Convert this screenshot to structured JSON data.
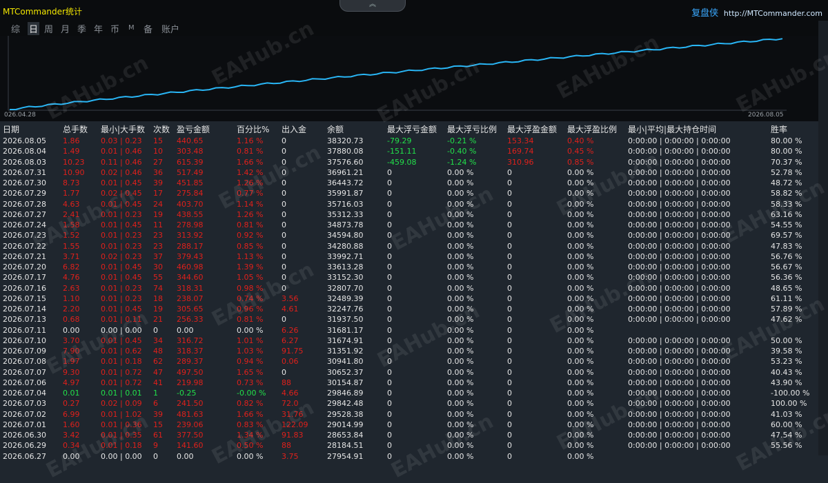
{
  "app": {
    "title": "MTCommander统计",
    "brand_name": "复盘侠",
    "brand_url": "http://MTCommander.com",
    "handle_icon": "chevron-up-icon"
  },
  "periods": [
    {
      "label": "综",
      "active": false
    },
    {
      "label": "日",
      "active": true
    },
    {
      "label": "周",
      "active": false
    },
    {
      "label": "月",
      "active": false
    },
    {
      "label": "季",
      "active": false
    },
    {
      "label": "年",
      "active": false
    },
    {
      "label": "币",
      "active": false
    },
    {
      "label": "M",
      "active": false
    },
    {
      "label": "备",
      "active": false
    },
    {
      "label": "账户",
      "active": false
    }
  ],
  "chart_data": {
    "type": "line",
    "x_start": "026.04.28",
    "x_end": "2026.08.05",
    "line_color": "#29b6f6",
    "trend": "steady upward equity curve"
  },
  "watermark": "EAHub.cn",
  "headers": [
    "日期",
    "总手数",
    "最小|大手数",
    "次数",
    "盈亏金额",
    "百分比%",
    "出入金",
    "余额",
    "最大浮亏金额",
    "最大浮亏比例",
    "最大浮盈金额",
    "最大浮盈比例",
    "最小|平均|最大持仓时间",
    "胜率"
  ],
  "colors": {
    "red": "#e0201b",
    "green": "#22e04a",
    "white": "#e6e6e6"
  },
  "rows": [
    {
      "date": "2026.08.05",
      "lots": "1.86",
      "minmax": "0.03 | 0.23",
      "count": "15",
      "pnl": "440.65",
      "pct": "1.16 %",
      "io": "0",
      "bal": "38320.73",
      "fl": "-79.29",
      "flp": "-0.21 %",
      "fp": "153.34",
      "fpp": "0.40 %",
      "hold": "0:00:00 | 0:00:00 | 0:00:00",
      "win": "80.00 %",
      "c": "r",
      "fc": "g"
    },
    {
      "date": "2026.08.04",
      "lots": "1.49",
      "minmax": "0.01 | 0.46",
      "count": "10",
      "pnl": "303.48",
      "pct": "0.81 %",
      "io": "0",
      "bal": "37880.08",
      "fl": "-151.11",
      "flp": "-0.40 %",
      "fp": "169.74",
      "fpp": "0.45 %",
      "hold": "0:00:00 | 0:00:00 | 0:00:00",
      "win": "80.00 %",
      "c": "r",
      "fc": "g"
    },
    {
      "date": "2026.08.03",
      "lots": "10.23",
      "minmax": "0.11 | 0.46",
      "count": "27",
      "pnl": "615.39",
      "pct": "1.66 %",
      "io": "0",
      "bal": "37576.60",
      "fl": "-459.08",
      "flp": "-1.24 %",
      "fp": "310.96",
      "fpp": "0.85 %",
      "hold": "0:00:00 | 0:00:00 | 0:00:00",
      "win": "70.37 %",
      "c": "r",
      "fc": "g"
    },
    {
      "date": "2026.07.31",
      "lots": "10.90",
      "minmax": "0.02 | 0.46",
      "count": "36",
      "pnl": "517.49",
      "pct": "1.42 %",
      "io": "0",
      "bal": "36961.21",
      "fl": "0",
      "flp": "0.00 %",
      "fp": "0",
      "fpp": "0.00 %",
      "hold": "0:00:00 | 0:00:00 | 0:00:00",
      "win": "52.78 %",
      "c": "r",
      "fc": "w"
    },
    {
      "date": "2026.07.30",
      "lots": "8.73",
      "minmax": "0.01 | 0.45",
      "count": "39",
      "pnl": "451.85",
      "pct": "1.26 %",
      "io": "0",
      "bal": "36443.72",
      "fl": "0",
      "flp": "0.00 %",
      "fp": "0",
      "fpp": "0.00 %",
      "hold": "0:00:00 | 0:00:00 | 0:00:00",
      "win": "48.72 %",
      "c": "r",
      "fc": "w"
    },
    {
      "date": "2026.07.29",
      "lots": "1.77",
      "minmax": "0.02 | 0.45",
      "count": "17",
      "pnl": "275.84",
      "pct": "0.77 %",
      "io": "0",
      "bal": "35991.87",
      "fl": "0",
      "flp": "0.00 %",
      "fp": "0",
      "fpp": "0.00 %",
      "hold": "0:00:00 | 0:00:00 | 0:00:00",
      "win": "58.82 %",
      "c": "r",
      "fc": "w"
    },
    {
      "date": "2026.07.28",
      "lots": "4.63",
      "minmax": "0.01 | 0.45",
      "count": "24",
      "pnl": "403.70",
      "pct": "1.14 %",
      "io": "0",
      "bal": "35716.03",
      "fl": "0",
      "flp": "0.00 %",
      "fp": "0",
      "fpp": "0.00 %",
      "hold": "0:00:00 | 0:00:00 | 0:00:00",
      "win": "58.33 %",
      "c": "r",
      "fc": "w"
    },
    {
      "date": "2026.07.27",
      "lots": "2.41",
      "minmax": "0.01 | 0.23",
      "count": "19",
      "pnl": "438.55",
      "pct": "1.26 %",
      "io": "0",
      "bal": "35312.33",
      "fl": "0",
      "flp": "0.00 %",
      "fp": "0",
      "fpp": "0.00 %",
      "hold": "0:00:00 | 0:00:00 | 0:00:00",
      "win": "63.16 %",
      "c": "r",
      "fc": "w"
    },
    {
      "date": "2026.07.24",
      "lots": "1.58",
      "minmax": "0.01 | 0.45",
      "count": "11",
      "pnl": "278.98",
      "pct": "0.81 %",
      "io": "0",
      "bal": "34873.78",
      "fl": "0",
      "flp": "0.00 %",
      "fp": "0",
      "fpp": "0.00 %",
      "hold": "0:00:00 | 0:00:00 | 0:00:00",
      "win": "54.55 %",
      "c": "r",
      "fc": "w"
    },
    {
      "date": "2026.07.23",
      "lots": "1.52",
      "minmax": "0.01 | 0.23",
      "count": "23",
      "pnl": "313.92",
      "pct": "0.92 %",
      "io": "0",
      "bal": "34594.80",
      "fl": "0",
      "flp": "0.00 %",
      "fp": "0",
      "fpp": "0.00 %",
      "hold": "0:00:00 | 0:00:00 | 0:00:00",
      "win": "69.57 %",
      "c": "r",
      "fc": "w"
    },
    {
      "date": "2026.07.22",
      "lots": "1.55",
      "minmax": "0.01 | 0.23",
      "count": "23",
      "pnl": "288.17",
      "pct": "0.85 %",
      "io": "0",
      "bal": "34280.88",
      "fl": "0",
      "flp": "0.00 %",
      "fp": "0",
      "fpp": "0.00 %",
      "hold": "0:00:00 | 0:00:00 | 0:00:00",
      "win": "47.83 %",
      "c": "r",
      "fc": "w"
    },
    {
      "date": "2026.07.21",
      "lots": "3.71",
      "minmax": "0.02 | 0.23",
      "count": "37",
      "pnl": "379.43",
      "pct": "1.13 %",
      "io": "0",
      "bal": "33992.71",
      "fl": "0",
      "flp": "0.00 %",
      "fp": "0",
      "fpp": "0.00 %",
      "hold": "0:00:00 | 0:00:00 | 0:00:00",
      "win": "56.76 %",
      "c": "r",
      "fc": "w"
    },
    {
      "date": "2026.07.20",
      "lots": "6.82",
      "minmax": "0.01 | 0.45",
      "count": "30",
      "pnl": "460.98",
      "pct": "1.39 %",
      "io": "0",
      "bal": "33613.28",
      "fl": "0",
      "flp": "0.00 %",
      "fp": "0",
      "fpp": "0.00 %",
      "hold": "0:00:00 | 0:00:00 | 0:00:00",
      "win": "56.67 %",
      "c": "r",
      "fc": "w"
    },
    {
      "date": "2026.07.17",
      "lots": "4.76",
      "minmax": "0.01 | 0.45",
      "count": "55",
      "pnl": "344.60",
      "pct": "1.05 %",
      "io": "0",
      "bal": "33152.30",
      "fl": "0",
      "flp": "0.00 %",
      "fp": "0",
      "fpp": "0.00 %",
      "hold": "0:00:00 | 0:00:00 | 0:00:00",
      "win": "56.36 %",
      "c": "r",
      "fc": "w"
    },
    {
      "date": "2026.07.16",
      "lots": "2.63",
      "minmax": "0.01 | 0.23",
      "count": "74",
      "pnl": "318.31",
      "pct": "0.98 %",
      "io": "0",
      "bal": "32807.70",
      "fl": "0",
      "flp": "0.00 %",
      "fp": "0",
      "fpp": "0.00 %",
      "hold": "0:00:00 | 0:00:00 | 0:00:00",
      "win": "48.65 %",
      "c": "r",
      "fc": "w"
    },
    {
      "date": "2026.07.15",
      "lots": "1.10",
      "minmax": "0.01 | 0.23",
      "count": "18",
      "pnl": "238.07",
      "pct": "0.74 %",
      "io": "3.56",
      "bal": "32489.39",
      "fl": "0",
      "flp": "0.00 %",
      "fp": "0",
      "fpp": "0.00 %",
      "hold": "0:00:00 | 0:00:00 | 0:00:00",
      "win": "61.11 %",
      "c": "r",
      "fc": "w"
    },
    {
      "date": "2026.07.14",
      "lots": "2.20",
      "minmax": "0.01 | 0.45",
      "count": "19",
      "pnl": "305.65",
      "pct": "0.96 %",
      "io": "4.61",
      "bal": "32247.76",
      "fl": "0",
      "flp": "0.00 %",
      "fp": "0",
      "fpp": "0.00 %",
      "hold": "0:00:00 | 0:00:00 | 0:00:00",
      "win": "57.89 %",
      "c": "r",
      "fc": "w"
    },
    {
      "date": "2026.07.13",
      "lots": "0.68",
      "minmax": "0.01 | 0.11",
      "count": "21",
      "pnl": "256.33",
      "pct": "0.81 %",
      "io": "0",
      "bal": "31937.50",
      "fl": "0",
      "flp": "0.00 %",
      "fp": "0",
      "fpp": "0.00 %",
      "hold": "0:00:00 | 0:00:00 | 0:00:00",
      "win": "47.62 %",
      "c": "r",
      "fc": "w"
    },
    {
      "date": "2026.07.11",
      "lots": "0.00",
      "minmax": "0.00 | 0.00",
      "count": "0",
      "pnl": "0.00",
      "pct": "0.00 %",
      "io": "6.26",
      "bal": "31681.17",
      "fl": "0",
      "flp": "0.00 %",
      "fp": "0",
      "fpp": "0.00 %",
      "hold": "",
      "win": "",
      "c": "w",
      "fc": "w",
      "io_c": "r"
    },
    {
      "date": "2026.07.10",
      "lots": "3.70",
      "minmax": "0.01 | 0.45",
      "count": "34",
      "pnl": "316.72",
      "pct": "1.01 %",
      "io": "6.27",
      "bal": "31674.91",
      "fl": "0",
      "flp": "0.00 %",
      "fp": "0",
      "fpp": "0.00 %",
      "hold": "0:00:00 | 0:00:00 | 0:00:00",
      "win": "50.00 %",
      "c": "r",
      "fc": "w"
    },
    {
      "date": "2026.07.09",
      "lots": "7.90",
      "minmax": "0.01 | 0.62",
      "count": "48",
      "pnl": "318.37",
      "pct": "1.03 %",
      "io": "91.75",
      "bal": "31351.92",
      "fl": "0",
      "flp": "0.00 %",
      "fp": "0",
      "fpp": "0.00 %",
      "hold": "0:00:00 | 0:00:00 | 0:00:00",
      "win": "39.58 %",
      "c": "r",
      "fc": "w"
    },
    {
      "date": "2026.07.08",
      "lots": "1.97",
      "minmax": "0.01 | 0.18",
      "count": "62",
      "pnl": "289.37",
      "pct": "0.94 %",
      "io": "0.06",
      "bal": "30941.80",
      "fl": "0",
      "flp": "0.00 %",
      "fp": "0",
      "fpp": "0.00 %",
      "hold": "0:00:00 | 0:00:00 | 0:00:00",
      "win": "53.23 %",
      "c": "r",
      "fc": "w"
    },
    {
      "date": "2026.07.07",
      "lots": "9.30",
      "minmax": "0.01 | 0.72",
      "count": "47",
      "pnl": "497.50",
      "pct": "1.65 %",
      "io": "0",
      "bal": "30652.37",
      "fl": "0",
      "flp": "0.00 %",
      "fp": "0",
      "fpp": "0.00 %",
      "hold": "0:00:00 | 0:00:00 | 0:00:00",
      "win": "40.43 %",
      "c": "r",
      "fc": "w"
    },
    {
      "date": "2026.07.06",
      "lots": "4.97",
      "minmax": "0.01 | 0.72",
      "count": "41",
      "pnl": "219.98",
      "pct": "0.73 %",
      "io": "88",
      "bal": "30154.87",
      "fl": "0",
      "flp": "0.00 %",
      "fp": "0",
      "fpp": "0.00 %",
      "hold": "0:00:00 | 0:00:00 | 0:00:00",
      "win": "43.90 %",
      "c": "r",
      "fc": "w"
    },
    {
      "date": "2026.07.04",
      "lots": "0.01",
      "minmax": "0.01 | 0.01",
      "count": "1",
      "pnl": "-0.25",
      "pct": "-0.00 %",
      "io": "4.66",
      "bal": "29846.89",
      "fl": "0",
      "flp": "0.00 %",
      "fp": "0",
      "fpp": "0.00 %",
      "hold": "0:00:00 | 0:00:00 | 0:00:00",
      "win": "-100.00 %",
      "c": "g",
      "fc": "w",
      "io_c": "r"
    },
    {
      "date": "2026.07.03",
      "lots": "0.27",
      "minmax": "0.02 | 0.09",
      "count": "6",
      "pnl": "241.50",
      "pct": "0.82 %",
      "io": "72.0",
      "bal": "29842.48",
      "fl": "0",
      "flp": "0.00 %",
      "fp": "0",
      "fpp": "0.00 %",
      "hold": "0:00:00 | 0:00:00 | 0:00:00",
      "win": "100.00 %",
      "c": "r",
      "fc": "w"
    },
    {
      "date": "2026.07.02",
      "lots": "6.99",
      "minmax": "0.01 | 1.02",
      "count": "39",
      "pnl": "481.63",
      "pct": "1.66 %",
      "io": "31.76",
      "bal": "29528.38",
      "fl": "0",
      "flp": "0.00 %",
      "fp": "0",
      "fpp": "0.00 %",
      "hold": "0:00:00 | 0:00:00 | 0:00:00",
      "win": "41.03 %",
      "c": "r",
      "fc": "w"
    },
    {
      "date": "2026.07.01",
      "lots": "1.60",
      "minmax": "0.01 | 0.36",
      "count": "15",
      "pnl": "239.06",
      "pct": "0.83 %",
      "io": "122.09",
      "bal": "29014.99",
      "fl": "0",
      "flp": "0.00 %",
      "fp": "0",
      "fpp": "0.00 %",
      "hold": "0:00:00 | 0:00:00 | 0:00:00",
      "win": "60.00 %",
      "c": "r",
      "fc": "w"
    },
    {
      "date": "2026.06.30",
      "lots": "3.42",
      "minmax": "0.01 | 0.35",
      "count": "61",
      "pnl": "377.50",
      "pct": "1.34 %",
      "io": "91.83",
      "bal": "28653.84",
      "fl": "0",
      "flp": "0.00 %",
      "fp": "0",
      "fpp": "0.00 %",
      "hold": "0:00:00 | 0:00:00 | 0:00:00",
      "win": "47.54 %",
      "c": "r",
      "fc": "w"
    },
    {
      "date": "2026.06.29",
      "lots": "0.34",
      "minmax": "0.01 | 0.18",
      "count": "9",
      "pnl": "141.60",
      "pct": "0.50 %",
      "io": "88",
      "bal": "28184.51",
      "fl": "0",
      "flp": "0.00 %",
      "fp": "0",
      "fpp": "0.00 %",
      "hold": "0:00:00 | 0:00:00 | 0:00:00",
      "win": "55.56 %",
      "c": "r",
      "fc": "w"
    },
    {
      "date": "2026.06.27",
      "lots": "0.00",
      "minmax": "0.00 | 0.00",
      "count": "0",
      "pnl": "0.00",
      "pct": "0.00 %",
      "io": "3.75",
      "bal": "27954.91",
      "fl": "0",
      "flp": "0.00 %",
      "fp": "0",
      "fpp": "0.00 %",
      "hold": "",
      "win": "",
      "c": "w",
      "fc": "w",
      "io_c": "r"
    }
  ]
}
